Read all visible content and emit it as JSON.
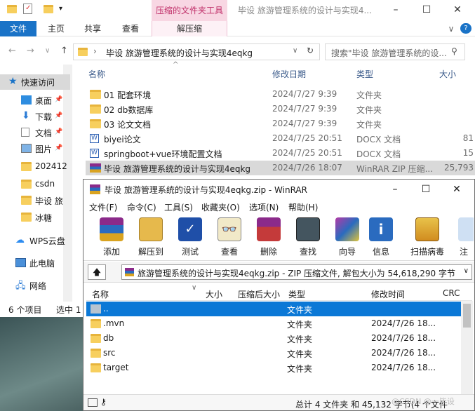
{
  "explorer": {
    "context_tab_group": "压缩的文件夹工具",
    "window_title": "毕设 旅游管理系统的设计与实现4...",
    "tabs": [
      "文件",
      "主页",
      "共享",
      "查看",
      "解压缩"
    ],
    "address": "毕设 旅游管理系统的设计与实现4eqkg",
    "search_placeholder": "搜索\"毕设 旅游管理系统的设...",
    "columns": {
      "name": "名称",
      "date": "修改日期",
      "type": "类型",
      "size": "大小"
    },
    "files": [
      {
        "name": "01 配套环境",
        "date": "2024/7/27 9:39",
        "type": "文件夹",
        "size": "",
        "icon": "folder-icon"
      },
      {
        "name": "02 db数据库",
        "date": "2024/7/27 9:39",
        "type": "文件夹",
        "size": "",
        "icon": "folder-icon"
      },
      {
        "name": "03 论文文档",
        "date": "2024/7/27 9:39",
        "type": "文件夹",
        "size": "",
        "icon": "folder-icon"
      },
      {
        "name": "biyei论文",
        "date": "2024/7/25 20:51",
        "type": "DOCX 文档",
        "size": "81",
        "icon": "word-doc-icon"
      },
      {
        "name": "springboot+vue环境配置文档",
        "date": "2024/7/25 20:51",
        "type": "DOCX 文档",
        "size": "15",
        "icon": "word-doc-icon"
      },
      {
        "name": "毕设 旅游管理系统的设计与实现4eqkg",
        "date": "2024/7/26 18:07",
        "type": "WinRAR ZIP 压缩...",
        "size": "25,793",
        "icon": "winrar-archive-icon"
      }
    ],
    "nav": [
      {
        "label": "快速访问",
        "icon": "star-icon",
        "pinned": false
      },
      {
        "label": "桌面",
        "icon": "desktop-icon",
        "pinned": true
      },
      {
        "label": "下载",
        "icon": "download-icon",
        "pinned": true
      },
      {
        "label": "文档",
        "icon": "document-icon",
        "pinned": true
      },
      {
        "label": "图片",
        "icon": "picture-icon",
        "pinned": true
      },
      {
        "label": "202412",
        "icon": "folder-icon",
        "pinned": false
      },
      {
        "label": "csdn",
        "icon": "folder-icon",
        "pinned": false
      },
      {
        "label": "毕设 旅",
        "icon": "folder-icon",
        "pinned": false
      },
      {
        "label": "冰糖",
        "icon": "folder-icon",
        "pinned": false
      },
      {
        "label": "WPS云盘",
        "icon": "cloud-icon",
        "pinned": false
      },
      {
        "label": "此电脑",
        "icon": "computer-icon",
        "pinned": false
      },
      {
        "label": "网络",
        "icon": "network-icon",
        "pinned": false
      }
    ],
    "status_count": "6 个项目",
    "status_selected": "选中 1"
  },
  "winrar": {
    "title": "毕设 旅游管理系统的设计与实现4eqkg.zip - WinRAR",
    "menu": [
      "文件(F)",
      "命令(C)",
      "工具(S)",
      "收藏夹(O)",
      "选项(N)",
      "帮助(H)"
    ],
    "toolbar": [
      "添加",
      "解压到",
      "测试",
      "查看",
      "删除",
      "查找",
      "向导",
      "信息",
      "扫描病毒",
      "注"
    ],
    "path": "旅游管理系统的设计与实现4eqkg.zip - ZIP 压缩文件, 解包大小为 54,618,290 字节",
    "columns": {
      "name": "名称",
      "size": "大小",
      "packed": "压缩后大小",
      "type": "类型",
      "modified": "修改时间",
      "crc": "CRC"
    },
    "rows": [
      {
        "name": "..",
        "type": "文件夹",
        "modified": ""
      },
      {
        "name": ".mvn",
        "type": "文件夹",
        "modified": "2024/7/26 18..."
      },
      {
        "name": "db",
        "type": "文件夹",
        "modified": "2024/7/26 18..."
      },
      {
        "name": "src",
        "type": "文件夹",
        "modified": "2024/7/26 18..."
      },
      {
        "name": "target",
        "type": "文件夹",
        "modified": "2024/7/26 18..."
      }
    ],
    "status": "总计 4 文件夹 和 45,132 字节(4 个文件"
  },
  "watermark": "@CSDN @一毕设"
}
